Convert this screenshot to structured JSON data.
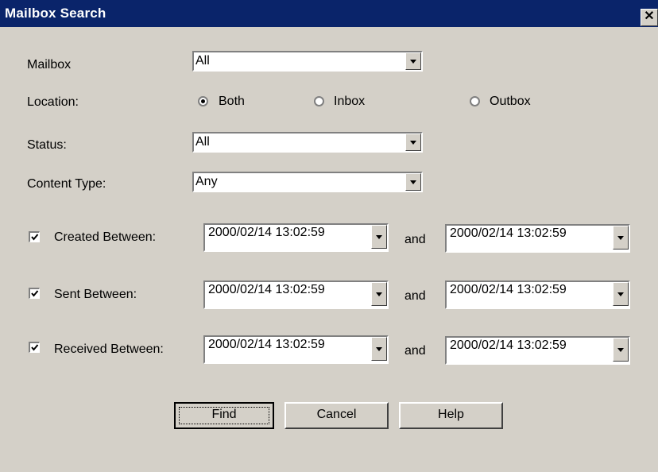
{
  "window": {
    "title": "Mailbox Search"
  },
  "mailbox": {
    "label": "Mailbox",
    "value": "All"
  },
  "location": {
    "label": "Location:",
    "options": [
      "Both",
      "Inbox",
      "Outbox"
    ],
    "selected": "Both"
  },
  "status": {
    "label": "Status:",
    "value": "All"
  },
  "content_type": {
    "label": "Content Type:",
    "value": "Any"
  },
  "ranges": [
    {
      "label": "Created Between:",
      "checked": true,
      "from": "2000/02/14  13:02:59",
      "and_label": "and",
      "to": "2000/02/14  13:02:59"
    },
    {
      "label": "Sent Between:",
      "checked": true,
      "from": "2000/02/14  13:02:59",
      "and_label": "and",
      "to": "2000/02/14  13:02:59"
    },
    {
      "label": "Received Between:",
      "checked": true,
      "from": "2000/02/14  13:02:59",
      "and_label": "and",
      "to": "2000/02/14  13:02:59"
    }
  ],
  "buttons": {
    "find": "Find",
    "cancel": "Cancel",
    "help": "Help"
  },
  "colors": {
    "titlebar": "#0a246a",
    "face": "#d4d0c8"
  },
  "icons": {
    "close": "close-icon",
    "dropdown": "chevron-down-icon",
    "check": "check-icon"
  }
}
